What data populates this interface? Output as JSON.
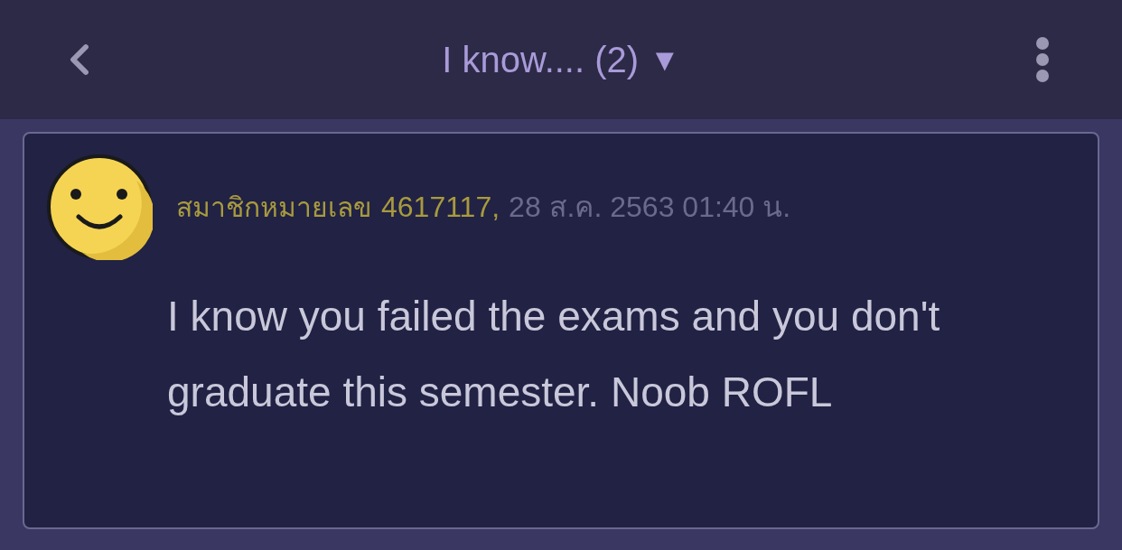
{
  "header": {
    "title": "I know.... (2)",
    "dropdown_glyph": "▼"
  },
  "post": {
    "author": "สมาชิกหมายเลข",
    "member_id": "4617117,",
    "timestamp": "28 ส.ค. 2563 01:40 น.",
    "body": "I know you failed the exams and you don't graduate this semester. Noob ROFL"
  }
}
